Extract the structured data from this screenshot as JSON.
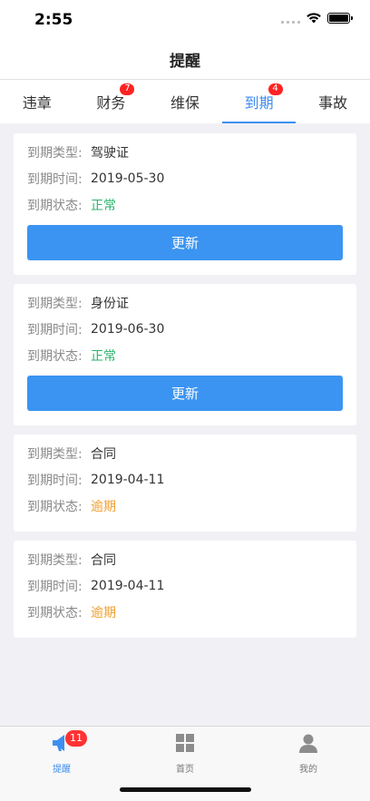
{
  "status_bar": {
    "time": "2:55"
  },
  "nav": {
    "title": "提醒"
  },
  "tabs": [
    {
      "label": "违章",
      "badge": ""
    },
    {
      "label": "财务",
      "badge": "7"
    },
    {
      "label": "维保",
      "badge": ""
    },
    {
      "label": "到期",
      "badge": "4",
      "active": true
    },
    {
      "label": "事故",
      "badge": ""
    }
  ],
  "labels": {
    "type": "到期类型:",
    "time": "到期时间:",
    "status": "到期状态:",
    "update_button": "更新"
  },
  "cards": [
    {
      "type": "驾驶证",
      "time": "2019-05-30",
      "status": "正常"
    },
    {
      "type": "身份证",
      "time": "2019-06-30",
      "status": "正常"
    },
    {
      "type": "合同",
      "time": "2019-04-11",
      "status": "逾期"
    },
    {
      "type": "合同",
      "time": "2019-04-11",
      "status": "逾期"
    }
  ],
  "bottom_nav": [
    {
      "label": "提醒",
      "icon": "megaphone-icon",
      "badge": "11",
      "active": true
    },
    {
      "label": "首页",
      "icon": "grid-icon"
    },
    {
      "label": "我的",
      "icon": "person-icon"
    }
  ],
  "colors": {
    "accent": "#3f8ef0",
    "normal": "#2ab36b",
    "overdue": "#f0a030",
    "badge": "#ff2222"
  }
}
